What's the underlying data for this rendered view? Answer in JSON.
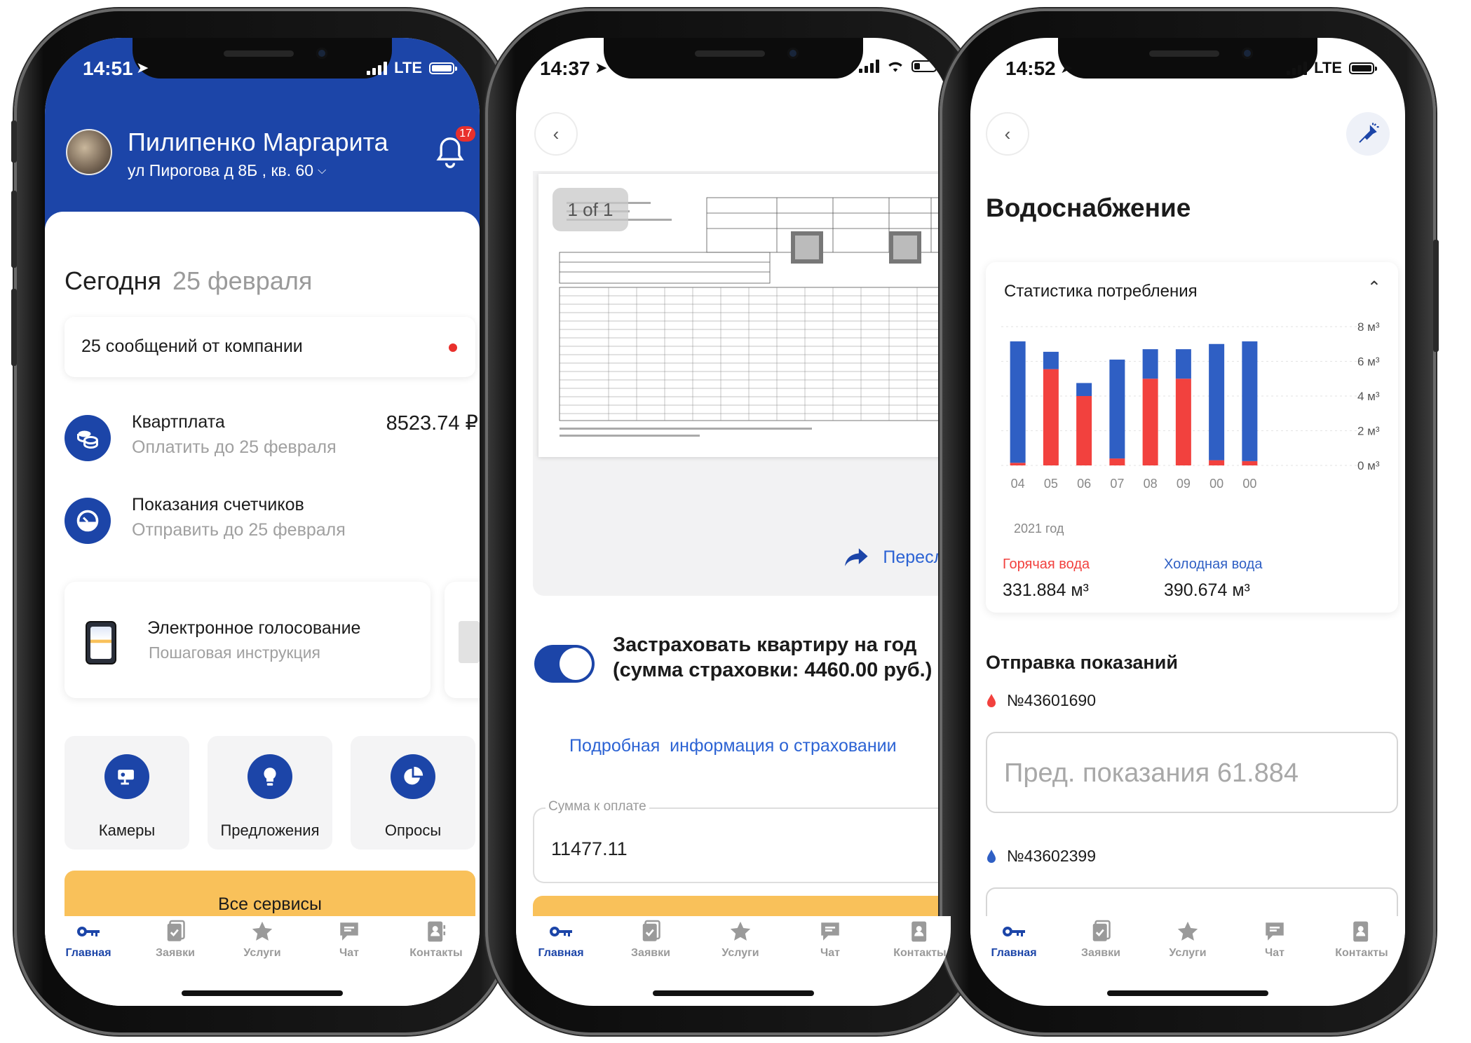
{
  "tabs": [
    "Главная",
    "Заявки",
    "Услуги",
    "Чат",
    "Контакты"
  ],
  "phone1": {
    "time": "14:51",
    "network": "LTE",
    "user_name": "Пилипенко Маргарита",
    "address": "ул Пирогова д 8Б , кв. 60",
    "notifications": "17",
    "today_label": "Сегодня",
    "today_date": "25 февраля",
    "messages": "25 сообщений от компании",
    "rent_title": "Квартплата",
    "rent_sub": "Оплатить до 25 февраля",
    "rent_amount": "8523.74 ₽",
    "meters_title": "Показания счетчиков",
    "meters_sub": "Отправить до 25 февраля",
    "vote_title": "Электронное голосование",
    "vote_sub": "Пошаговая инструкция",
    "services": [
      "Камеры",
      "Предложения",
      "Опросы"
    ],
    "all_services": "Все сервисы"
  },
  "phone2": {
    "time": "14:37",
    "page_counter": "1 of 1",
    "forward": "Переслать",
    "insurance_text": "Застраховать квартиру на год (сумма страховки: 4460.00 руб.)",
    "insurance_on": true,
    "insurance_link": "Подробная  информация о страховании",
    "amount_label": "Сумма к оплате",
    "amount_value": "11477.11"
  },
  "phone3": {
    "time": "14:52",
    "network": "LTE",
    "title": "Водоснабжение",
    "stats_title": "Статистика потребления",
    "year_label": "2021 год",
    "hot_label": "Горячая вода",
    "hot_value": "331.884 м³",
    "cold_label": "Холодная вода",
    "cold_value": "390.674 м³",
    "send_title": "Отправка показаний",
    "meter1": "№43601690",
    "meter1_placeholder": "Пред. показания 61.884",
    "meter2": "№43602399"
  },
  "colors": {
    "brand_blue": "#1c45a8",
    "hot_red": "#f2413e",
    "cold_blue": "#2f5fc4",
    "accent_yellow": "#f9c15a"
  },
  "chart_data": {
    "type": "bar",
    "stacked": true,
    "categories": [
      "04",
      "05",
      "06",
      "07",
      "08",
      "09",
      "00",
      "00"
    ],
    "series": [
      {
        "name": "Горячая вода",
        "color": "#f2413e",
        "values": [
          0.15,
          5.55,
          4.0,
          0.4,
          5.0,
          5.0,
          0.3,
          0.25
        ]
      },
      {
        "name": "Холодная вода",
        "color": "#2f5fc4",
        "values": [
          7.0,
          1.0,
          0.75,
          5.7,
          1.7,
          1.7,
          6.7,
          6.9
        ]
      }
    ],
    "y_ticks": [
      "0 м³",
      "2 м³",
      "4 м³",
      "6 м³",
      "8 м³"
    ],
    "ylim": [
      0,
      8
    ],
    "grid": true
  }
}
